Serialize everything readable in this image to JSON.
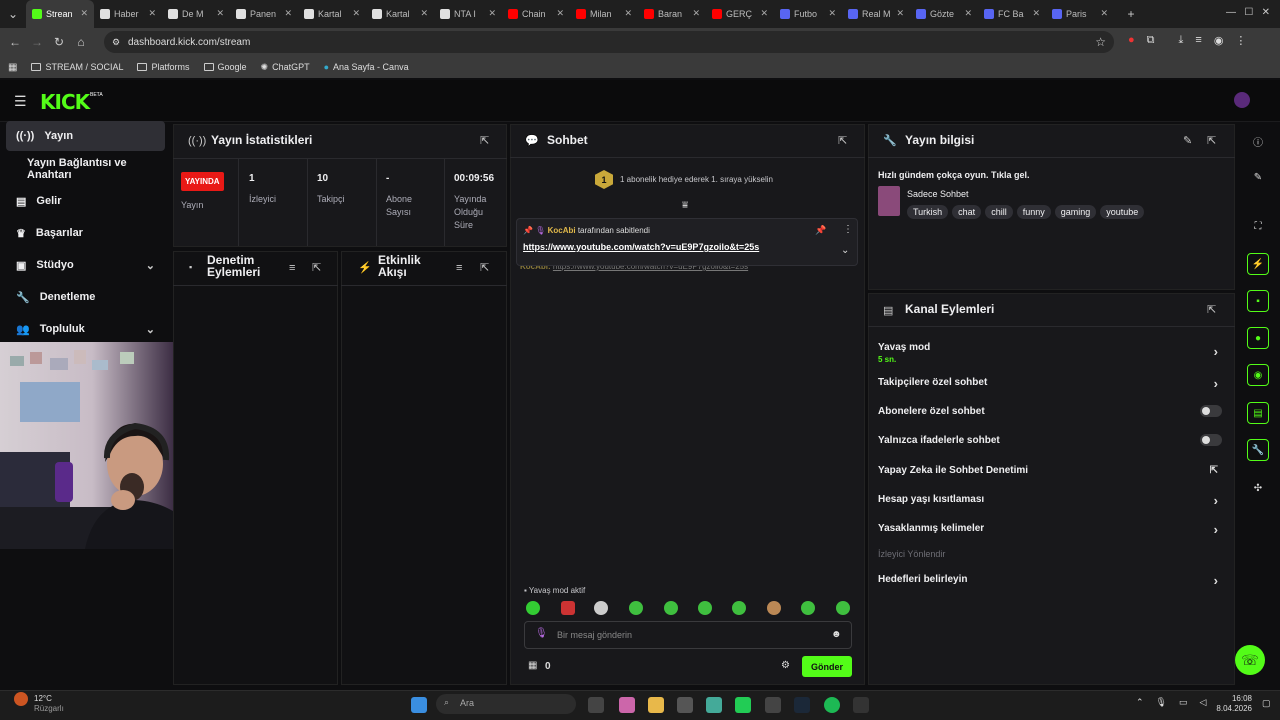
{
  "browser": {
    "tabs": [
      {
        "label": "Strean",
        "color": "#53fc18",
        "active": true
      },
      {
        "label": "Haber",
        "color": "#e0e0e0"
      },
      {
        "label": "De M",
        "color": "#e0e0e0"
      },
      {
        "label": "Panen",
        "color": "#e0e0e0"
      },
      {
        "label": "Kartal",
        "color": "#e0e0e0"
      },
      {
        "label": "Kartal",
        "color": "#e0e0e0"
      },
      {
        "label": "NTA I",
        "color": "#e0e0e0"
      },
      {
        "label": "Chain",
        "color": "#ff0000"
      },
      {
        "label": "Milan",
        "color": "#ff0000"
      },
      {
        "label": "Baran",
        "color": "#ff0000"
      },
      {
        "label": "GERÇ",
        "color": "#ff0000"
      },
      {
        "label": "Futbo",
        "color": "#5865f2"
      },
      {
        "label": "Real M",
        "color": "#5865f2"
      },
      {
        "label": "Gözte",
        "color": "#5865f2"
      },
      {
        "label": "FC Ba",
        "color": "#5865f2"
      },
      {
        "label": "Paris",
        "color": "#5865f2"
      }
    ],
    "url": "dashboard.kick.com/stream",
    "bookmarks": [
      "STREAM / SOCIAL",
      "Platforms",
      "Google",
      "ChatGPT",
      "Ana Sayfa - Canva"
    ]
  },
  "header": {
    "logo": "KICK",
    "beta": "BETA"
  },
  "sidebar": {
    "items": [
      {
        "label": "Yayın",
        "icon": "broadcast-icon"
      },
      {
        "label": "Yayın Bağlantısı ve Anahtarı"
      },
      {
        "label": "Gelir",
        "icon": "revenue-icon"
      },
      {
        "label": "Başarılar",
        "icon": "trophy-icon"
      },
      {
        "label": "Stüdyo",
        "icon": "studio-icon"
      },
      {
        "label": "Denetleme",
        "icon": "moderation-icon"
      },
      {
        "label": "Topluluk",
        "icon": "community-icon"
      }
    ]
  },
  "stats": {
    "title": "Yayın İstatistikleri",
    "live_badge": "YAYINDA",
    "live_label": "Yayın",
    "viewers_value": "1",
    "viewers_label": "İzleyici",
    "followers_value": "10",
    "followers_label": "Takipçi",
    "subs_value": "-",
    "subs_label": "Abone Sayısı",
    "uptime_value": "00:09:56",
    "uptime_label": "Yayında Olduğu Süre"
  },
  "modpanel": {
    "title": "Denetim Eylemleri"
  },
  "activity": {
    "title": "Etkinlik Akışı"
  },
  "chat": {
    "title": "Sohbet",
    "gift_badge": "1",
    "gift_text": "1 abonelik hediye ederek 1. sıraya yükselin",
    "pinned_by_user": "KocAbi",
    "pinned_by_text": "tarafından sabitlendi",
    "pinned_link": "https://www.youtube.com/watch?v=uE9P7gzoilo&t=25s",
    "message_user": "KocAbi:",
    "message_text": "https://www.youtube.com/watch?v=uE9P7gzoilo&t=25s",
    "slow_mode": "Yavaş mod aktif",
    "input_placeholder": "Bir mesaj gönderin",
    "points": "0",
    "send_label": "Gönder"
  },
  "stream_info": {
    "title": "Yayın bilgisi",
    "stream_title": "Hızlı gündem çokça oyun. Tıkla gel.",
    "category": "Sadece Sohbet",
    "tags": [
      "Turkish",
      "chat",
      "chill",
      "funny",
      "gaming",
      "youtube"
    ]
  },
  "channel_actions": {
    "title": "Kanal Eylemleri",
    "slow_mode": "Yavaş mod",
    "slow_mode_value": "5 sn.",
    "followers_only": "Takipçilere özel sohbet",
    "subs_only": "Abonelere özel sohbet",
    "emotes_only": "Yalnızca ifadelerle sohbet",
    "ai_mod": "Yapay Zeka ile Sohbet Denetimi",
    "age_restrict": "Hesap yaşı kısıtlaması",
    "banned_words": "Yasaklanmış kelimeler",
    "redirect_heading": "İzleyici Yönlendir",
    "goals": "Hedefleri belirleyin"
  },
  "taskbar": {
    "weather_temp": "12°C",
    "weather_desc": "Rüzgarlı",
    "search": "Ara",
    "time": "16:08",
    "date": "8.04.2026"
  }
}
